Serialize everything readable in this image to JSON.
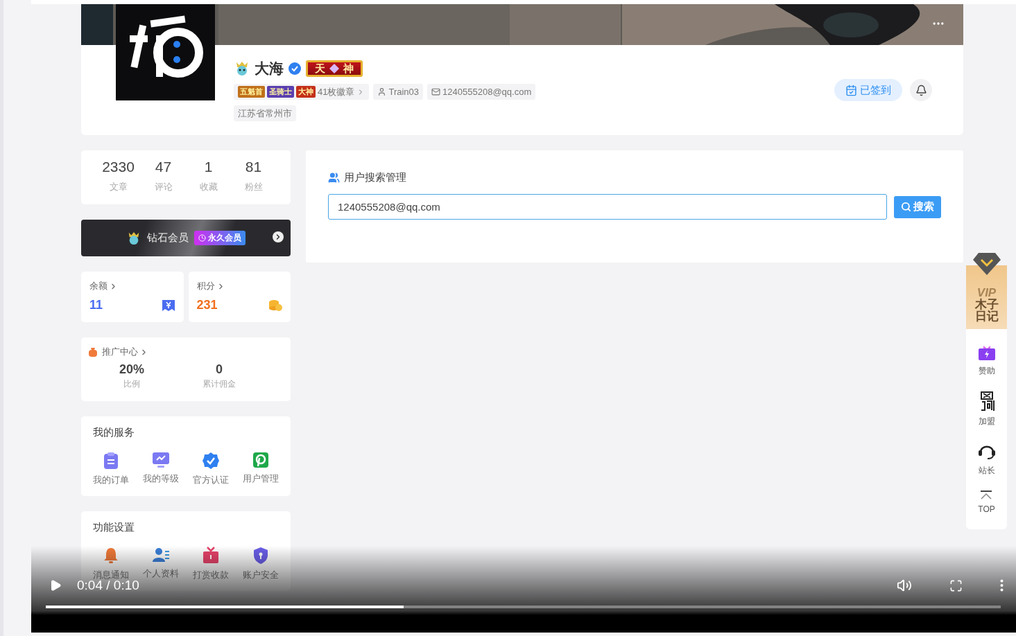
{
  "page": {
    "profile": {
      "name": "大海",
      "title_badge": [
        "天",
        "神"
      ],
      "medals": [
        "五魁首",
        "圣骑士",
        "大神"
      ],
      "badge_count": "41枚徽章",
      "username": "Train03",
      "email": "1240555208@qq.com",
      "location": "江苏省常州市",
      "checkin": "已签到"
    },
    "stats": [
      {
        "value": "2330",
        "label": "文章"
      },
      {
        "value": "47",
        "label": "评论"
      },
      {
        "value": "1",
        "label": "收藏"
      },
      {
        "value": "81",
        "label": "粉丝"
      }
    ],
    "membership": {
      "name": "钻石会员",
      "tag": "永久会员"
    },
    "wallet": [
      {
        "label": "余额",
        "value": "11",
        "kind": "balance"
      },
      {
        "label": "积分",
        "value": "231",
        "kind": "points"
      }
    ],
    "promotion": {
      "title": "推广中心",
      "items": [
        {
          "value": "20%",
          "label": "比例"
        },
        {
          "value": "0",
          "label": "累计佣金"
        }
      ]
    },
    "services": {
      "title": "我的服务",
      "items": [
        {
          "label": "我的订单",
          "kind": "order"
        },
        {
          "label": "我的等级",
          "kind": "level"
        },
        {
          "label": "官方认证",
          "kind": "verify"
        },
        {
          "label": "用户管理",
          "kind": "users"
        }
      ]
    },
    "settings": {
      "title": "功能设置",
      "items": [
        {
          "label": "消息通知",
          "kind": "bell"
        },
        {
          "label": "个人资料",
          "kind": "profile"
        },
        {
          "label": "打赏收款",
          "kind": "gift"
        },
        {
          "label": "账户安全",
          "kind": "shield"
        }
      ]
    },
    "search_panel": {
      "title": "用户搜索管理",
      "value": "1240555208@qq.com",
      "button": "搜索"
    },
    "float_bar": {
      "vip": {
        "tag": "VIP",
        "lines": [
          "木子",
          "日记"
        ]
      },
      "items": [
        {
          "label": "赞助",
          "kind": "sponsor"
        },
        {
          "label": "加盟",
          "kind": "join"
        },
        {
          "label": "站长",
          "kind": "support"
        },
        {
          "label": "TOP",
          "kind": "top"
        }
      ]
    }
  },
  "player": {
    "time": "0:04 / 0:10",
    "level": 0.375
  }
}
